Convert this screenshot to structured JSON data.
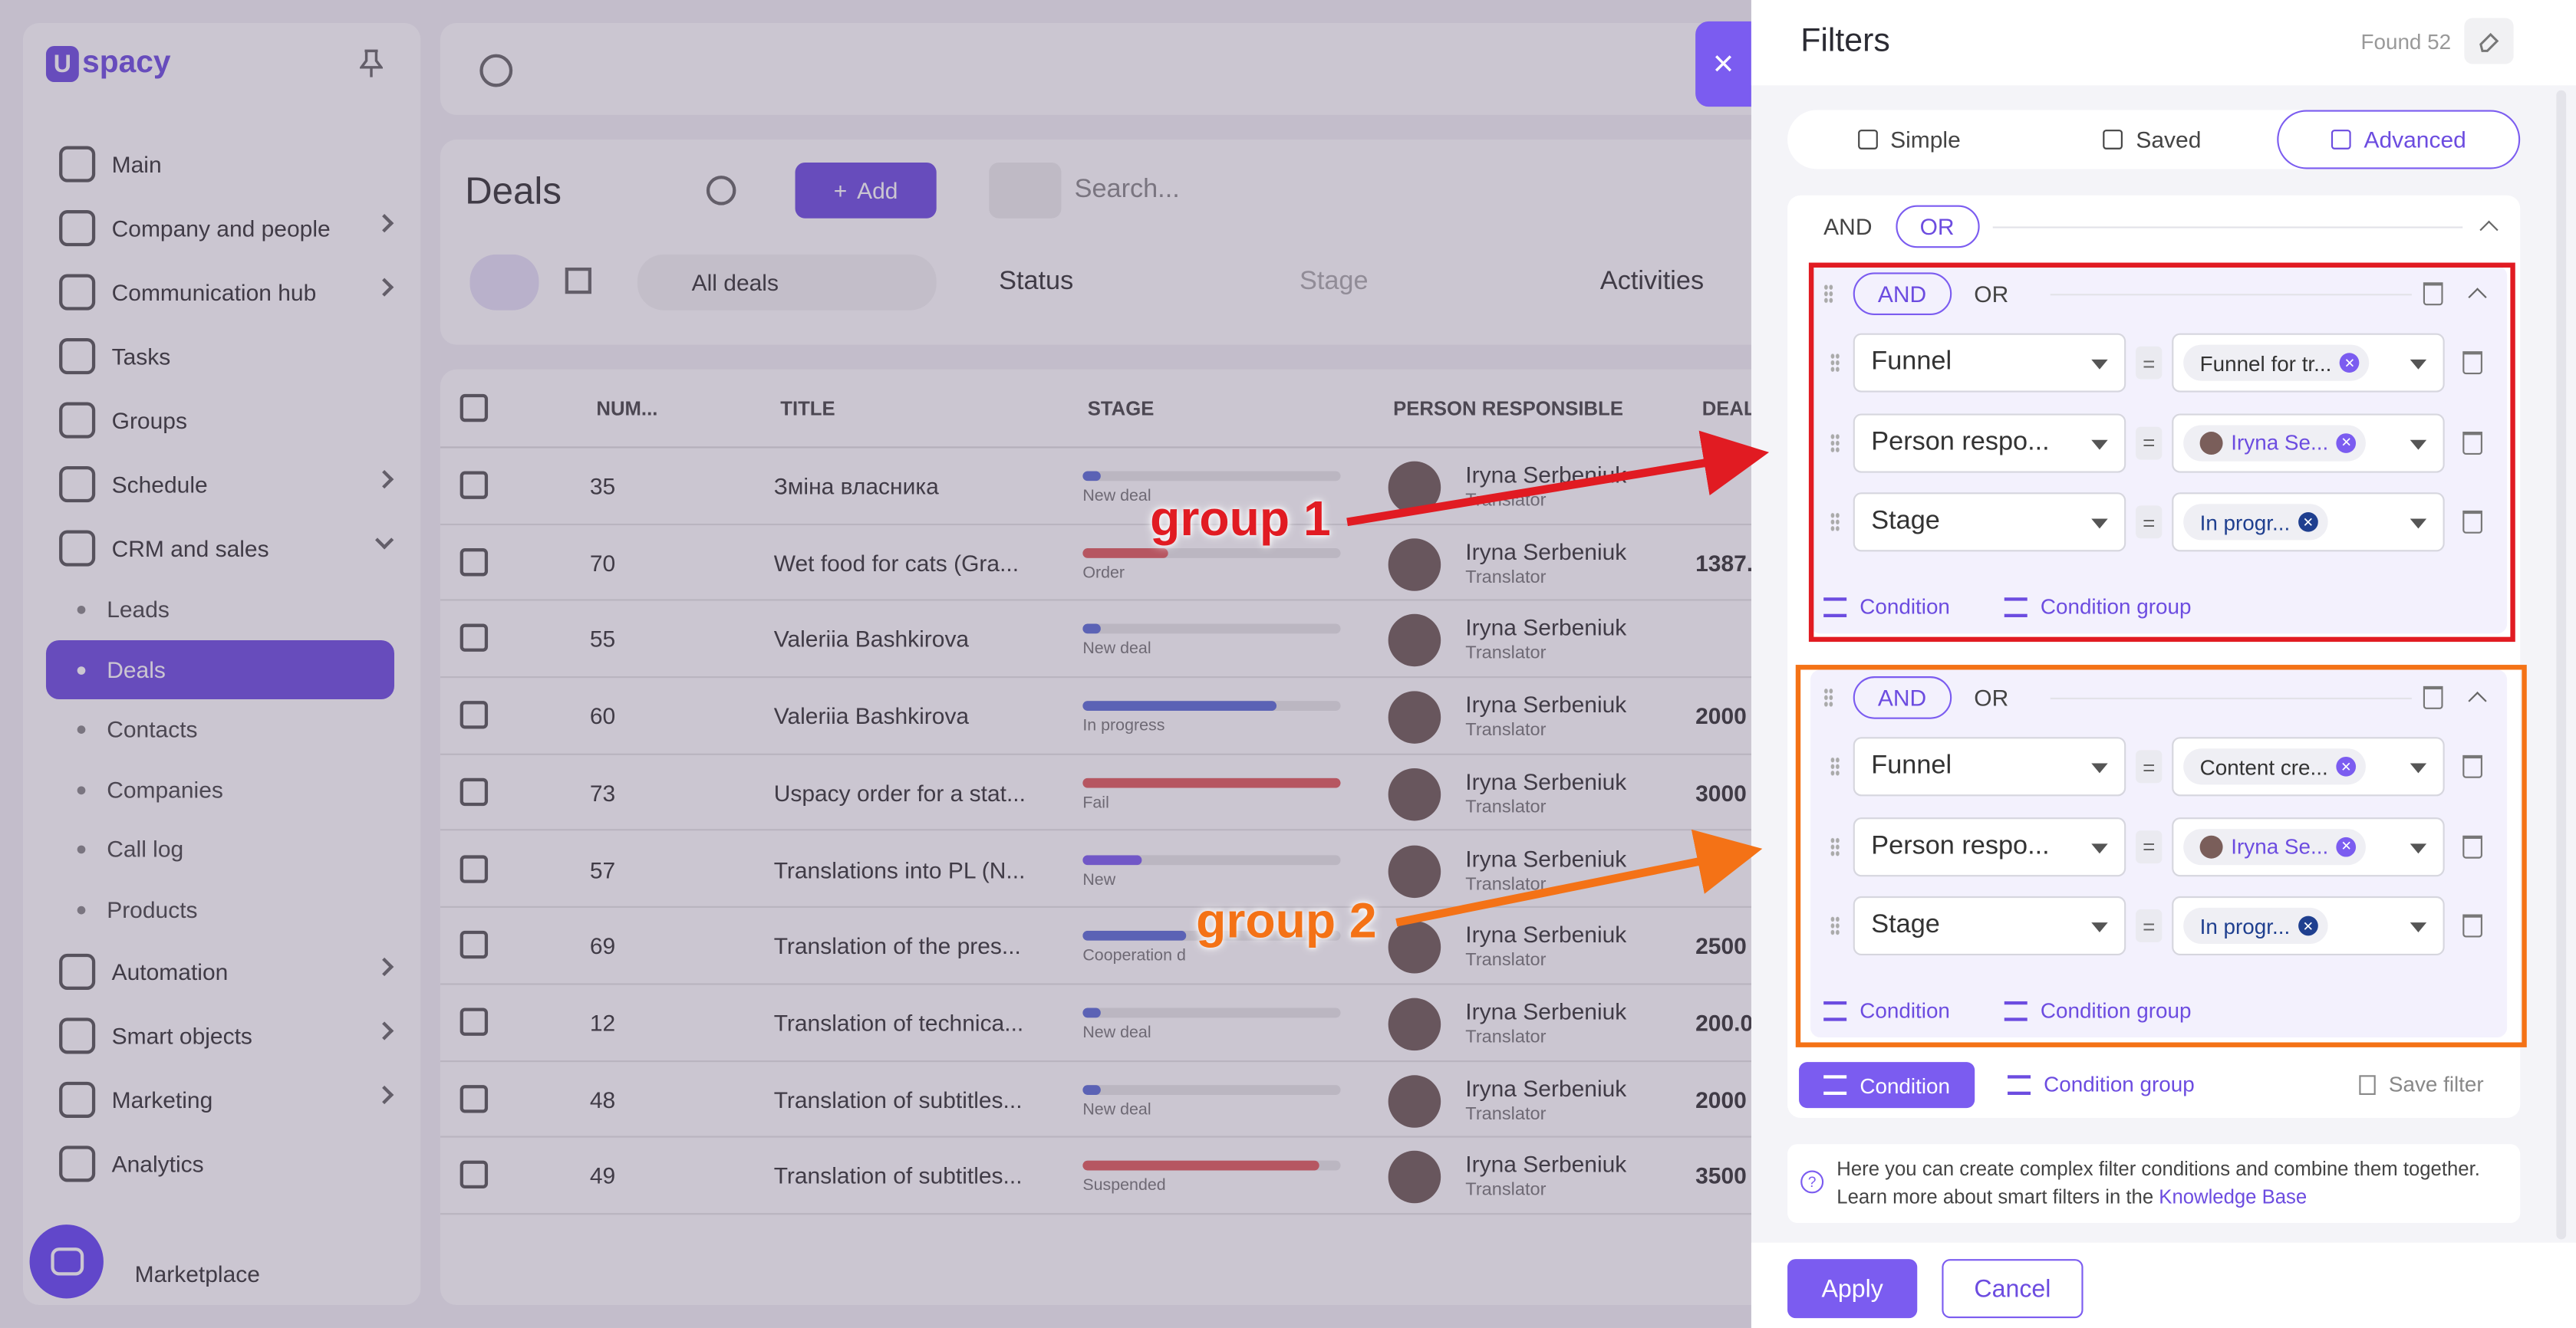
{
  "app": {
    "logo_letter": "U",
    "logo_text": "spacy",
    "sidebar": {
      "items": [
        {
          "label": "Main",
          "icon": "home-icon",
          "chevron": false
        },
        {
          "label": "Company and people",
          "icon": "building-icon",
          "chevron": true
        },
        {
          "label": "Communication hub",
          "icon": "chat-icon",
          "chevron": true
        },
        {
          "label": "Tasks",
          "icon": "check-circle-icon",
          "chevron": false
        },
        {
          "label": "Groups",
          "icon": "users-icon",
          "chevron": false
        },
        {
          "label": "Schedule",
          "icon": "calendar-icon",
          "chevron": true
        },
        {
          "label": "CRM and sales",
          "icon": "database-icon",
          "chevron": true,
          "expanded": true
        }
      ],
      "sub_items": [
        "Leads",
        "Deals",
        "Contacts",
        "Companies",
        "Call log",
        "Products"
      ],
      "active_sub": "Deals",
      "lower_items": [
        {
          "label": "Automation",
          "icon": "bolt-icon"
        },
        {
          "label": "Smart objects",
          "icon": "cube-icon"
        },
        {
          "label": "Marketing",
          "icon": "megaphone-icon"
        },
        {
          "label": "Analytics",
          "icon": "chart-icon"
        }
      ],
      "marketplace": "Marketplace"
    },
    "deals": {
      "title": "Deals",
      "add_label": "Add",
      "search_placeholder": "Search...",
      "view_filter": "All deals",
      "status_label": "Status",
      "stage_placeholder": "Stage",
      "activities_label": "Activities"
    },
    "table": {
      "headers": [
        "NUM...",
        "TITLE",
        "STAGE",
        "PERSON RESPONSIBLE",
        "DEAL"
      ],
      "rows": [
        {
          "num": "35",
          "title": "Зміна власника",
          "stage": "New deal",
          "stage_fill": 0.07,
          "stage_color": "#5b6cd6",
          "person": "Iryna Serbeniuk",
          "role": "Translator",
          "amount": ""
        },
        {
          "num": "70",
          "title": "Wet food for cats (Gra...",
          "stage": "Order",
          "stage_fill": 0.33,
          "stage_color": "#e05a5a",
          "person": "Iryna Serbeniuk",
          "role": "Translator",
          "amount": "1387."
        },
        {
          "num": "55",
          "title": "Valeriia Bashkirova",
          "stage": "New deal",
          "stage_fill": 0.07,
          "stage_color": "#5b6cd6",
          "person": "Iryna Serbeniuk",
          "role": "Translator",
          "amount": ""
        },
        {
          "num": "60",
          "title": "Valeriia Bashkirova",
          "stage": "In progress",
          "stage_fill": 0.75,
          "stage_color": "#5b6cd6",
          "person": "Iryna Serbeniuk",
          "role": "Translator",
          "amount": "2000"
        },
        {
          "num": "73",
          "title": "Uspacy order for a stat...",
          "stage": "Fail",
          "stage_fill": 1.0,
          "stage_color": "#e05a5a",
          "person": "Iryna Serbeniuk",
          "role": "Translator",
          "amount": "3000"
        },
        {
          "num": "57",
          "title": "Translations into PL (N...",
          "stage": "New",
          "stage_fill": 0.23,
          "stage_color": "#7b5cf0",
          "person": "Iryna Serbeniuk",
          "role": "Translator",
          "amount": ""
        },
        {
          "num": "69",
          "title": "Translation of the pres...",
          "stage": "Cooperation d",
          "stage_fill": 0.4,
          "stage_color": "#5b6cd6",
          "person": "Iryna Serbeniuk",
          "role": "Translator",
          "amount": "2500"
        },
        {
          "num": "12",
          "title": "Translation of technica...",
          "stage": "New deal",
          "stage_fill": 0.07,
          "stage_color": "#5b6cd6",
          "person": "Iryna Serbeniuk",
          "role": "Translator",
          "amount": "200.0"
        },
        {
          "num": "48",
          "title": "Translation of subtitles...",
          "stage": "New deal",
          "stage_fill": 0.07,
          "stage_color": "#5b6cd6",
          "person": "Iryna Serbeniuk",
          "role": "Translator",
          "amount": "2000"
        },
        {
          "num": "49",
          "title": "Translation of subtitles...",
          "stage": "Suspended",
          "stage_fill": 0.92,
          "stage_color": "#e05a5a",
          "person": "Iryna Serbeniuk",
          "role": "Translator",
          "amount": "3500"
        }
      ]
    }
  },
  "filters": {
    "title": "Filters",
    "found": "Found 52",
    "tabs": [
      {
        "label": "Simple",
        "icon": "sliders-icon",
        "active": false
      },
      {
        "label": "Saved",
        "icon": "bookmark-icon",
        "active": false
      },
      {
        "label": "Advanced",
        "icon": "advanced-filter-icon",
        "active": true
      }
    ],
    "root_ops": {
      "and": "AND",
      "or": "OR",
      "selected": "OR"
    },
    "groups": [
      {
        "ops": {
          "and": "AND",
          "or": "OR",
          "selected": "AND"
        },
        "conditions": [
          {
            "field": "Funnel",
            "op": "=",
            "value": "Funnel for tr...",
            "value_style": "plain",
            "has_avatar": false
          },
          {
            "field": "Person respo...",
            "op": "=",
            "value": "Iryna Se...",
            "value_style": "purple",
            "has_avatar": true
          },
          {
            "field": "Stage",
            "op": "=",
            "value": "In progr...",
            "value_style": "blue",
            "has_avatar": false
          }
        ],
        "add_condition": "Condition",
        "add_group": "Condition group"
      },
      {
        "ops": {
          "and": "AND",
          "or": "OR",
          "selected": "AND"
        },
        "conditions": [
          {
            "field": "Funnel",
            "op": "=",
            "value": "Content cre...",
            "value_style": "plain",
            "has_avatar": false
          },
          {
            "field": "Person respo...",
            "op": "=",
            "value": "Iryna Se...",
            "value_style": "purple",
            "has_avatar": true
          },
          {
            "field": "Stage",
            "op": "=",
            "value": "In progr...",
            "value_style": "blue",
            "has_avatar": false
          }
        ],
        "add_condition": "Condition",
        "add_group": "Condition group"
      }
    ],
    "add_condition": "Condition",
    "add_group": "Condition group",
    "save_filter": "Save filter",
    "info_text": "Here you can create complex filter conditions and combine them together. Learn more about smart filters in the",
    "info_link": "Knowledge Base",
    "apply": "Apply",
    "cancel": "Cancel"
  },
  "annotations": {
    "group1": "group 1",
    "group2": "group 2",
    "color1": "#e11b22",
    "color2": "#f47216"
  }
}
